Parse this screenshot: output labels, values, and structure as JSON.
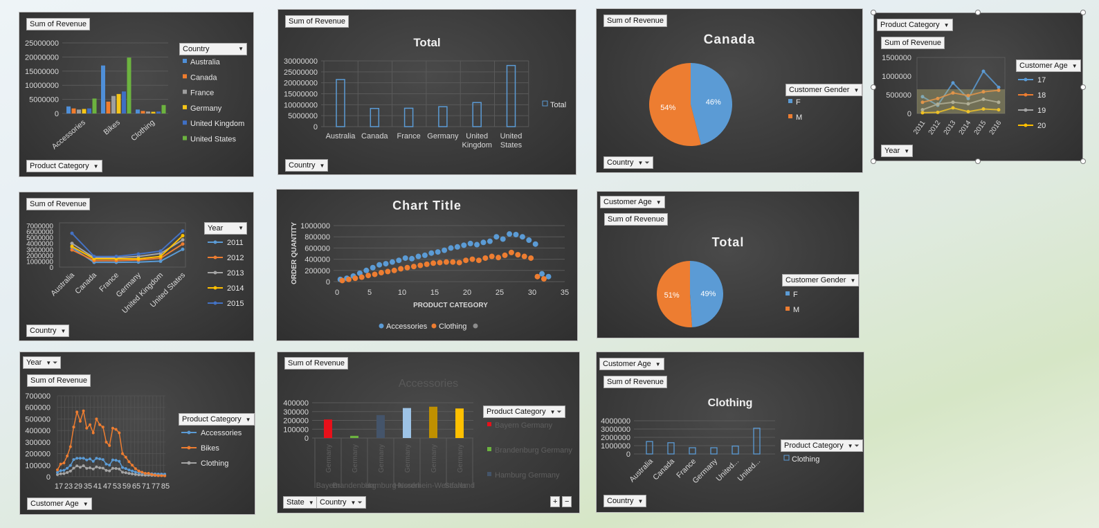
{
  "colors": {
    "australia": "#4f8fd8",
    "canada": "#f07d2e",
    "france": "#9e9e9e",
    "germany": "#f5c518",
    "uk": "#3f6fc4",
    "us": "#6cb33f",
    "blue": "#5b9bd5",
    "orange": "#ed7d31",
    "gray": "#a5a5a5",
    "gold": "#ffc000"
  },
  "chart1": {
    "value_button": "Sum of Revenue",
    "legend_filter": "Country",
    "axis_filter": "Product Category",
    "yticks": [
      "25000000",
      "20000000",
      "15000000",
      "10000000",
      "5000000",
      "0"
    ],
    "categories": [
      "Accessories",
      "Bikes",
      "Clothing"
    ],
    "legend": [
      "Australia",
      "Canada",
      "France",
      "Germany",
      "United Kingdom",
      "United States"
    ]
  },
  "chart2": {
    "value_button": "Sum of Revenue",
    "title": "Total",
    "axis_filter": "Country",
    "yticks": [
      "30000000",
      "25000000",
      "20000000",
      "15000000",
      "10000000",
      "5000000",
      "0"
    ],
    "categories": [
      "Australia",
      "Canada",
      "France",
      "Germany",
      "United Kingdom",
      "United States"
    ],
    "legend": "Total"
  },
  "chart3": {
    "value_button": "Sum of Revenue",
    "title": "Canada",
    "legend_filter": "Customer Gender",
    "axis_filter": "Country",
    "legend": [
      "F",
      "M"
    ],
    "labels": [
      "46%",
      "54%"
    ]
  },
  "chart4": {
    "axis_filter_top": "Product Category",
    "value_button": "Sum of Revenue",
    "legend_filter": "Customer Age",
    "axis_filter": "Year",
    "yticks": [
      "1500000",
      "1000000",
      "500000",
      "0"
    ],
    "categories": [
      "2011",
      "2012",
      "2013",
      "2014",
      "2015",
      "2016"
    ],
    "legend": [
      "17",
      "18",
      "19",
      "20"
    ]
  },
  "chart5": {
    "value_button": "Sum of Revenue",
    "legend_filter": "Year",
    "axis_filter": "Country",
    "yticks": [
      "7000000",
      "6000000",
      "5000000",
      "4000000",
      "3000000",
      "2000000",
      "1000000",
      "0"
    ],
    "categories": [
      "Australia",
      "Canada",
      "France",
      "Germany",
      "United Kingdom",
      "United States"
    ],
    "legend": [
      "2011",
      "2012",
      "2013",
      "2014",
      "2015"
    ]
  },
  "chart6": {
    "title": "Chart Title",
    "ylabel": "ORDER QUANTITY",
    "xlabel": "PRODUCT CATEGORY",
    "yticks": [
      "1000000",
      "800000",
      "600000",
      "400000",
      "200000",
      "0"
    ],
    "xticks": [
      "0",
      "5",
      "10",
      "15",
      "20",
      "25",
      "30",
      "35"
    ],
    "legend": [
      "Accessories",
      "Clothing"
    ]
  },
  "chart7": {
    "filter_top": "Customer Age",
    "value_button": "Sum of Revenue",
    "title": "Total",
    "legend_filter": "Customer Gender",
    "legend": [
      "F",
      "M"
    ],
    "labels": [
      "49%",
      "51%"
    ]
  },
  "chart8": {
    "filter_top": "Year",
    "value_button": "Sum of Revenue",
    "legend_filter": "Product Category",
    "axis_filter": "Customer Age",
    "yticks": [
      "700000",
      "600000",
      "500000",
      "400000",
      "300000",
      "200000",
      "100000",
      "0"
    ],
    "xticks": [
      "17",
      "23",
      "29",
      "35",
      "41",
      "47",
      "53",
      "59",
      "65",
      "71",
      "77",
      "85"
    ],
    "legend": [
      "Accessories",
      "Bikes",
      "Clothing"
    ]
  },
  "chart9": {
    "value_button": "Sum of Revenue",
    "title": "Accessories",
    "legend_filter": "Product Category",
    "axis_filter1": "State",
    "axis_filter2": "Country",
    "yticks": [
      "400000",
      "300000",
      "200000",
      "100000",
      "0"
    ],
    "inner_labels": [
      "Germany",
      "Germany",
      "Germany",
      "Germany",
      "Germany",
      "Germany"
    ],
    "outer_labels": [
      "Bayern",
      "Brandenburg",
      "Hamburg",
      "Hessen",
      "Nordrhein-Westfalen",
      "Saarland"
    ],
    "legend": [
      "Bayern Germany",
      "Brandenburg Germany",
      "Hamburg Germany"
    ],
    "plus": "+",
    "minus": "−"
  },
  "chart10": {
    "filter_top": "Customer Age",
    "value_button": "Sum of Revenue",
    "title": "Clothing",
    "legend_filter": "Product Category",
    "axis_filter": "Country",
    "yticks": [
      "4000000",
      "3000000",
      "2000000",
      "1000000",
      "0"
    ],
    "categories": [
      "Australia",
      "Canada",
      "France",
      "Germany",
      "United...",
      "United..."
    ],
    "legend": "Clothing"
  }
}
